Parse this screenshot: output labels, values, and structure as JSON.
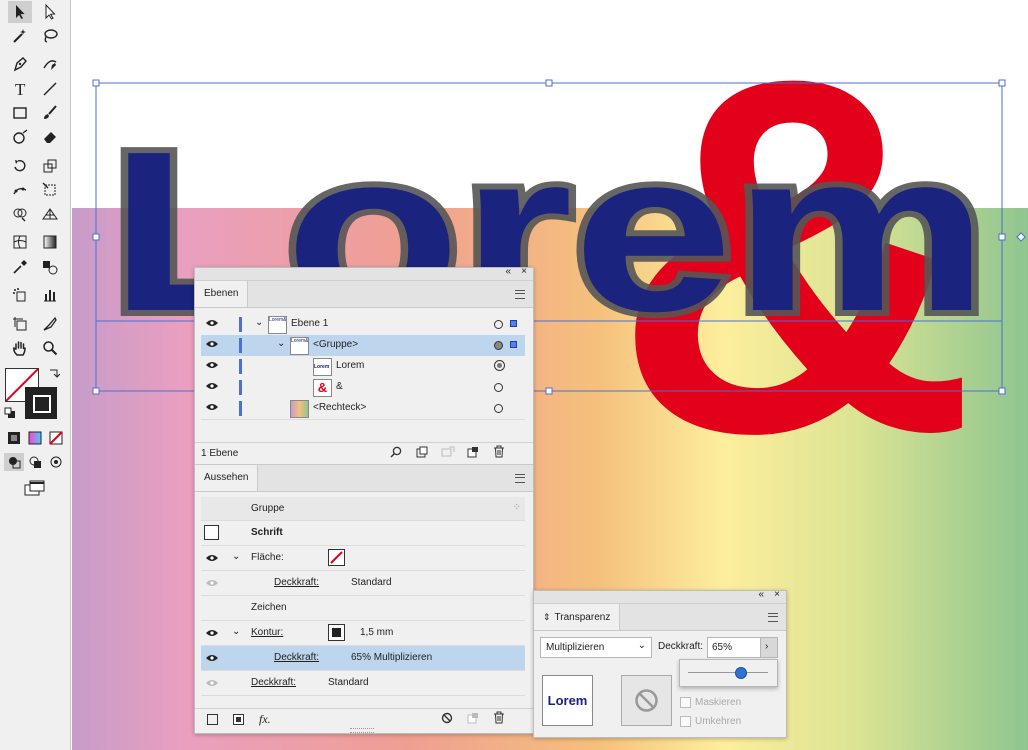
{
  "canvas": {
    "headline": "Lorem",
    "ampersand": "&",
    "colors": {
      "headline_fill": "#1a237e",
      "headline_stroke": "#555555",
      "ampersand": "#e2001a",
      "selection": "#4a6fd6"
    }
  },
  "toolbar": {
    "tools": [
      "selection-tool",
      "direct-selection-tool",
      "magic-wand-tool",
      "lasso-tool",
      "pen-tool",
      "curvature-tool",
      "type-tool",
      "line-segment-tool",
      "rectangle-tool",
      "paintbrush-tool",
      "shaper-tool",
      "eraser-tool",
      "rotate-tool",
      "scale-tool",
      "puppet-warp-tool",
      "free-transform-tool",
      "shape-builder-tool",
      "perspective-grid-tool",
      "mesh-tool",
      "gradient-tool",
      "eyedropper-tool",
      "blend-tool",
      "symbol-sprayer-tool",
      "column-graph-tool",
      "artboard-tool",
      "slice-tool",
      "hand-tool",
      "zoom-tool"
    ]
  },
  "layers_panel": {
    "tab": "Ebenen",
    "rows": [
      {
        "name": "Ebene 1",
        "thumb": "Lorem&"
      },
      {
        "name": "<Gruppe>",
        "thumb": "Lorem&"
      },
      {
        "name": "Lorem",
        "thumb": "Lorem"
      },
      {
        "name": "&",
        "thumb": "&"
      },
      {
        "name": "<Rechteck>",
        "thumb": ""
      }
    ],
    "footer_count": "1 Ebene"
  },
  "appearance_panel": {
    "tab": "Aussehen",
    "header": "Gruppe",
    "object": "Schrift",
    "fill_label": "Fläche:",
    "fill_opacity_label": "Deckkraft:",
    "fill_opacity_value": "Standard",
    "characters": "Zeichen",
    "stroke_label": "Kontur:",
    "stroke_width": "1,5 mm",
    "stroke_opacity_label": "Deckkraft:",
    "stroke_opacity_value": "65% Multiplizieren",
    "opacity_label": "Deckkraft:",
    "opacity_value": "Standard",
    "fx": "fx."
  },
  "transparency_panel": {
    "tab": "Transparenz",
    "blend_mode": "Multiplizieren",
    "opacity_label": "Deckkraft:",
    "opacity_value": "65%",
    "opacity_fraction": 0.65,
    "thumb_text": "Lorem",
    "mask_label": "Maskieren",
    "invert_label": "Umkehren"
  }
}
